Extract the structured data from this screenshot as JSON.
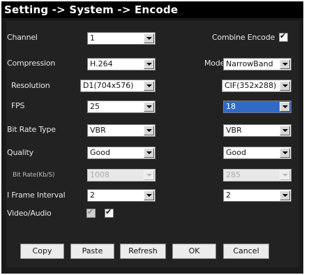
{
  "window": {
    "title": "Setting -> System -> Encode"
  },
  "form": {
    "channel": {
      "label": "Channel",
      "value": "1"
    },
    "combine_encode": {
      "label": "Combine Encode",
      "checked": true
    },
    "compression": {
      "label": "Compression",
      "value": "H.264"
    },
    "mode": {
      "label": "Mode",
      "value": "NarrowBand"
    },
    "resolution": {
      "label": "Resolution",
      "main": "D1(704x576)",
      "extra": "CIF(352x288)"
    },
    "fps": {
      "label": "FPS",
      "main": "25",
      "extra": "18"
    },
    "bit_rate_type": {
      "label": "Bit Rate Type",
      "main": "VBR",
      "extra": "VBR"
    },
    "quality": {
      "label": "Quality",
      "main": "Good",
      "extra": "Good"
    },
    "bit_rate": {
      "label": "Bit Rate(Kb/S)",
      "main": "1008",
      "extra": "285"
    },
    "i_frame_interval": {
      "label": "I Frame Interval",
      "main": "2",
      "extra": "2"
    },
    "video_audio": {
      "label": "Video/Audio",
      "main_checked": true,
      "extra_checked": true
    }
  },
  "buttons": {
    "copy": "Copy",
    "paste": "Paste",
    "refresh": "Refresh",
    "ok": "OK",
    "cancel": "Cancel"
  }
}
